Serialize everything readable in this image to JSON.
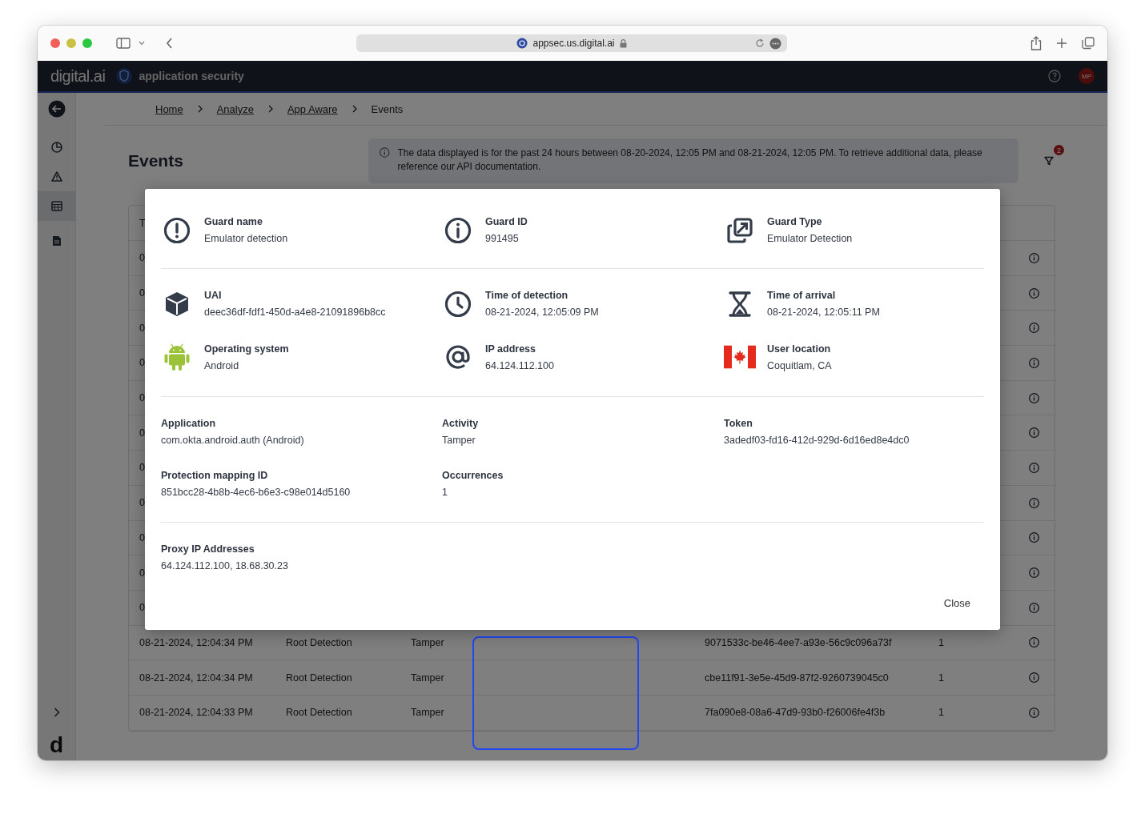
{
  "browser": {
    "url": "appsec.us.digital.ai"
  },
  "header": {
    "logo": "digital.ai",
    "product": "application security",
    "avatar": "MP"
  },
  "breadcrumbs": [
    {
      "label": "Home",
      "link": true
    },
    {
      "label": "Analyze",
      "link": true
    },
    {
      "label": "App Aware",
      "link": true
    },
    {
      "label": "Events",
      "link": false
    }
  ],
  "sidebar": {
    "items": [
      {
        "kind": "chart",
        "selected": false
      },
      {
        "kind": "warning",
        "selected": false
      },
      {
        "kind": "table",
        "selected": true
      },
      {
        "kind": "document",
        "selected": false
      }
    ],
    "footer_logo": "d"
  },
  "page": {
    "title": "Events",
    "notice": "The data displayed is for the past 24 hours between 08-20-2024, 12:05 PM and 08-21-2024, 12:05 PM. To retrieve additional data, please reference our API documentation.",
    "filter_count": "2"
  },
  "table": {
    "header_first": "T",
    "rows": [
      {
        "cells": [
          "0"
        ]
      },
      {
        "cells": [
          "0"
        ]
      },
      {
        "cells": [
          "0"
        ]
      },
      {
        "cells": [
          "0"
        ]
      },
      {
        "cells": [
          "0"
        ]
      },
      {
        "cells": [
          "0"
        ]
      },
      {
        "cells": [
          "0"
        ]
      },
      {
        "cells": [
          "0"
        ]
      },
      {
        "cells": [
          "0"
        ]
      },
      {
        "cells": [
          "0"
        ]
      },
      {
        "cells": [
          "0"
        ]
      },
      {
        "cells": [
          "08-21-2024, 12:04:34 PM",
          "Root Detection",
          "Tamper",
          "9071533c-be46-4ee7-a93e-56c9c096a73f",
          "1"
        ]
      },
      {
        "cells": [
          "08-21-2024, 12:04:34 PM",
          "Root Detection",
          "Tamper",
          "cbe11f91-3e5e-45d9-87f2-9260739045c0",
          "1"
        ]
      },
      {
        "cells": [
          "08-21-2024, 12:04:33 PM",
          "Root Detection",
          "Tamper",
          "7fa090e8-08a6-47d9-93b0-f26006fe4f3b",
          "1"
        ]
      }
    ]
  },
  "modal": {
    "sections": [
      {
        "kind": "icons",
        "items": [
          {
            "kind": "alert",
            "label": "Guard name",
            "value": "Emulator detection"
          },
          {
            "kind": "info",
            "label": "Guard ID",
            "value": "991495"
          },
          {
            "kind": "guard_type",
            "label": "Guard Type",
            "value": "Emulator Detection"
          }
        ]
      },
      {
        "kind": "icons",
        "items": [
          {
            "kind": "cube",
            "label": "UAI",
            "value": "deec36df-fdf1-450d-a4e8-21091896b8cc"
          },
          {
            "kind": "clock",
            "label": "Time of detection",
            "value": "08-21-2024, 12:05:09 PM"
          },
          {
            "kind": "hourglass",
            "label": "Time of arrival",
            "value": "08-21-2024, 12:05:11 PM"
          },
          {
            "kind": "android",
            "label": "Operating system",
            "value": "Android"
          },
          {
            "kind": "at",
            "label": "IP address",
            "value": "64.124.112.100"
          },
          {
            "kind": "flag",
            "label": "User location",
            "value": "Coquitlam, CA"
          }
        ]
      },
      {
        "kind": "plain",
        "items": [
          {
            "label": "Application",
            "value": "com.okta.android.auth (Android)"
          },
          {
            "label": "Activity",
            "value": "Tamper"
          },
          {
            "label": "Token",
            "value": "3adedf03-fd16-412d-929d-6d16ed8e4dc0"
          },
          {
            "label": "Protection mapping ID",
            "value": "851bcc28-4b8b-4ec6-b6e3-c98e014d5160"
          },
          {
            "label": "Occurrences",
            "value": "1"
          }
        ]
      },
      {
        "kind": "plain",
        "items": [
          {
            "label": "Proxy IP Addresses",
            "value": "64.124.112.100, 18.68.30.23"
          }
        ]
      }
    ],
    "close": "Close"
  }
}
